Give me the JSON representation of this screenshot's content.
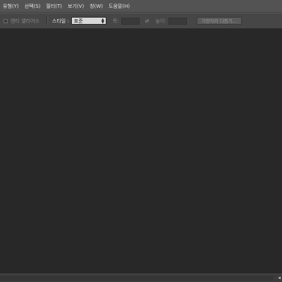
{
  "menu": {
    "items": [
      "유형(Y)",
      "선택(S)",
      "필터(T)",
      "보기(V)",
      "창(W)",
      "도움말(H)"
    ]
  },
  "options": {
    "anti_alias_label": "앤티 앨리어스",
    "style_label": "스타일 :",
    "style_value": "표준",
    "width_label": "폭:",
    "height_label": "높이:",
    "refine_edge_label": "가장자리 다듬기..."
  },
  "icons": {
    "swap": "swap-arrows-icon",
    "expand": "expand-panels-icon"
  },
  "colors": {
    "menubar": "#535353",
    "optionsbar": "#464646",
    "workspace": "#282828"
  }
}
